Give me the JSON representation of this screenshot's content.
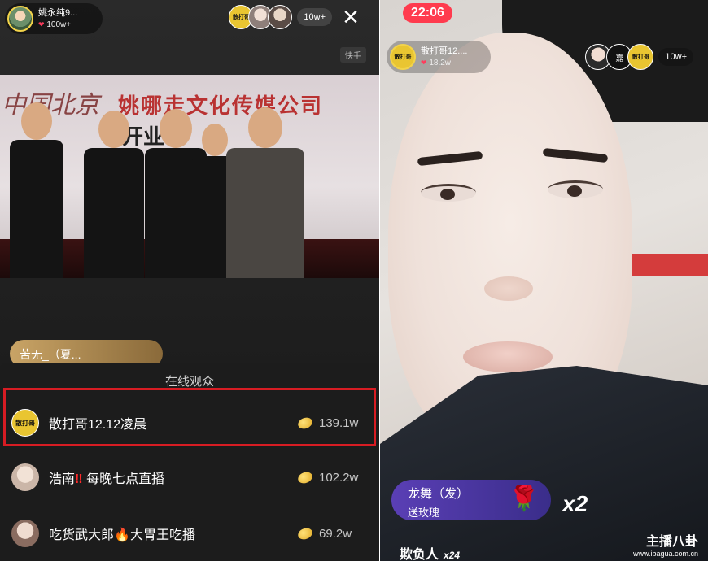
{
  "left": {
    "host": {
      "name": "姚永纯9...",
      "likes": "100w+"
    },
    "viewer_badge": "散打哥",
    "viewer_count": "10w+",
    "close_icon": "close-icon",
    "platform_tag": "快手",
    "banner": {
      "left_text": "中国北京",
      "main_text": "姚哪走文化传媒公司",
      "sub_text": "开业"
    },
    "comment_chip": "苦无_（夏...",
    "sheet": {
      "title": "在线观众",
      "rows": [
        {
          "avatar_label": "散打哥",
          "name": "散打哥12.12凌晨",
          "amount": "139.1w"
        },
        {
          "name_prefix": "浩南",
          "warn": "‼",
          "name_suffix": "每晚七点直播",
          "amount": "102.2w"
        },
        {
          "name_prefix": "吃货武大郎",
          "fire": "🔥",
          "name_suffix": "大胃王吃播",
          "amount": "69.2w"
        }
      ]
    },
    "highlight_color": "#d71c23"
  },
  "right": {
    "time": "22:06",
    "host": {
      "avatar_label": "散打哥",
      "name": "散打哥12....",
      "likes": "18.2w"
    },
    "viewers": [
      "",
      "嘉",
      "散打哥"
    ],
    "viewer_count": "10w+",
    "gift": {
      "sender": "龙舞（发）",
      "desc": "送玫瑰",
      "multiplier": "x2",
      "icon": "rose-icon"
    },
    "bottom_user": {
      "name": "欺负人",
      "count": "x24"
    },
    "watermark": {
      "main": "主播八卦",
      "url": "www.ibagua.com.cn"
    }
  }
}
